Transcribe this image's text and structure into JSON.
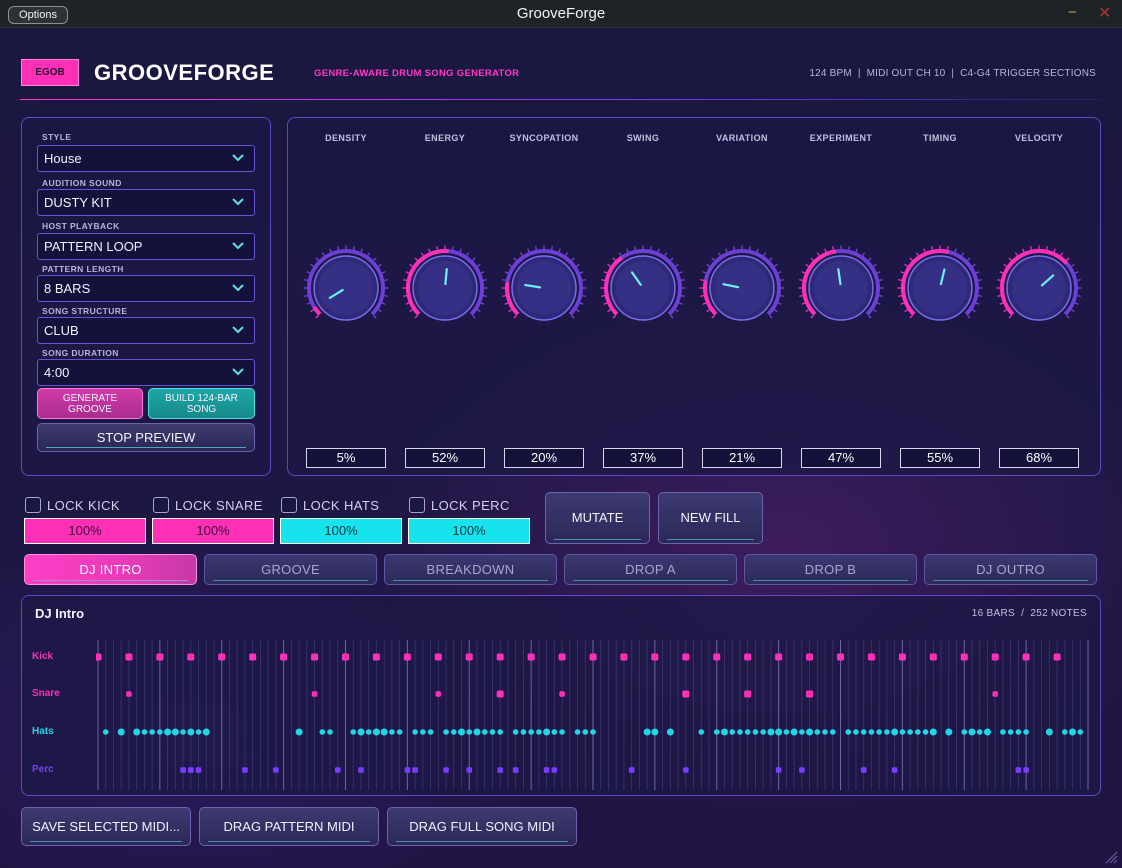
{
  "window": {
    "title": "GrooveForge",
    "options_label": "Options",
    "minimize_glyph": "−",
    "close_glyph": "✕"
  },
  "header": {
    "badge": "EGOB",
    "brand": "GROOVEFORGE",
    "tagline": "GENRE-AWARE DRUM SONG GENERATOR",
    "status": "124 BPM  |  MIDI OUT CH 10  |  C4-G4 TRIGGER SECTIONS"
  },
  "controls": {
    "style": {
      "label": "STYLE",
      "value": "House"
    },
    "audition": {
      "label": "AUDITION SOUND",
      "value": "DUSTY KIT"
    },
    "playback": {
      "label": "HOST PLAYBACK",
      "value": "PATTERN LOOP"
    },
    "length": {
      "label": "PATTERN LENGTH",
      "value": "8 BARS"
    },
    "structure": {
      "label": "SONG STRUCTURE",
      "value": "CLUB"
    },
    "duration": {
      "label": "SONG DURATION",
      "value": "4:00"
    },
    "generate_line1": "GENERATE",
    "generate_line2": "GROOVE",
    "build_line1": "BUILD 124-BAR",
    "build_line2": "SONG",
    "stop_label": "STOP PREVIEW"
  },
  "knobs": [
    {
      "label": "DENSITY",
      "value_text": "5%",
      "value": 0.05
    },
    {
      "label": "ENERGY",
      "value_text": "52%",
      "value": 0.52
    },
    {
      "label": "SYNCOPATION",
      "value_text": "20%",
      "value": 0.2
    },
    {
      "label": "SWING",
      "value_text": "37%",
      "value": 0.37
    },
    {
      "label": "VARIATION",
      "value_text": "21%",
      "value": 0.21
    },
    {
      "label": "EXPERIMENT",
      "value_text": "47%",
      "value": 0.47
    },
    {
      "label": "TIMING",
      "value_text": "55%",
      "value": 0.55
    },
    {
      "label": "VELOCITY",
      "value_text": "68%",
      "value": 0.68
    }
  ],
  "locks": [
    {
      "label": "LOCK KICK",
      "level_text": "100%",
      "level": 1.0,
      "color": "pink"
    },
    {
      "label": "LOCK SNARE",
      "level_text": "100%",
      "level": 1.0,
      "color": "pink"
    },
    {
      "label": "LOCK HATS",
      "level_text": "100%",
      "level": 1.0,
      "color": "cyan"
    },
    {
      "label": "LOCK PERC",
      "level_text": "100%",
      "level": 1.0,
      "color": "cyan"
    }
  ],
  "actions": {
    "mutate": "MUTATE",
    "new_fill": "NEW FILL"
  },
  "sections": [
    {
      "label": "DJ INTRO",
      "active": true
    },
    {
      "label": "GROOVE",
      "active": false
    },
    {
      "label": "BREAKDOWN",
      "active": false
    },
    {
      "label": "DROP A",
      "active": false
    },
    {
      "label": "DROP B",
      "active": false
    },
    {
      "label": "DJ OUTRO",
      "active": false
    }
  ],
  "pattern": {
    "title": "DJ Intro",
    "meta": "16 BARS  /  252 NOTES",
    "rows": [
      {
        "label": "Kick",
        "color": "#ff2fb8"
      },
      {
        "label": "Snare",
        "color": "#ff2fb8"
      },
      {
        "label": "Hats",
        "color": "#1fd8e6"
      },
      {
        "label": "Perc",
        "color": "#7b3cff"
      }
    ]
  },
  "bottom": {
    "save": "SAVE SELECTED MIDI...",
    "drag_pattern": "DRAG PATTERN MIDI",
    "drag_song": "DRAG FULL SONG MIDI"
  },
  "colors": {
    "accent_pink": "#ff2fb8",
    "accent_cyan": "#17e3ef",
    "accent_purple": "#7b3cff"
  }
}
